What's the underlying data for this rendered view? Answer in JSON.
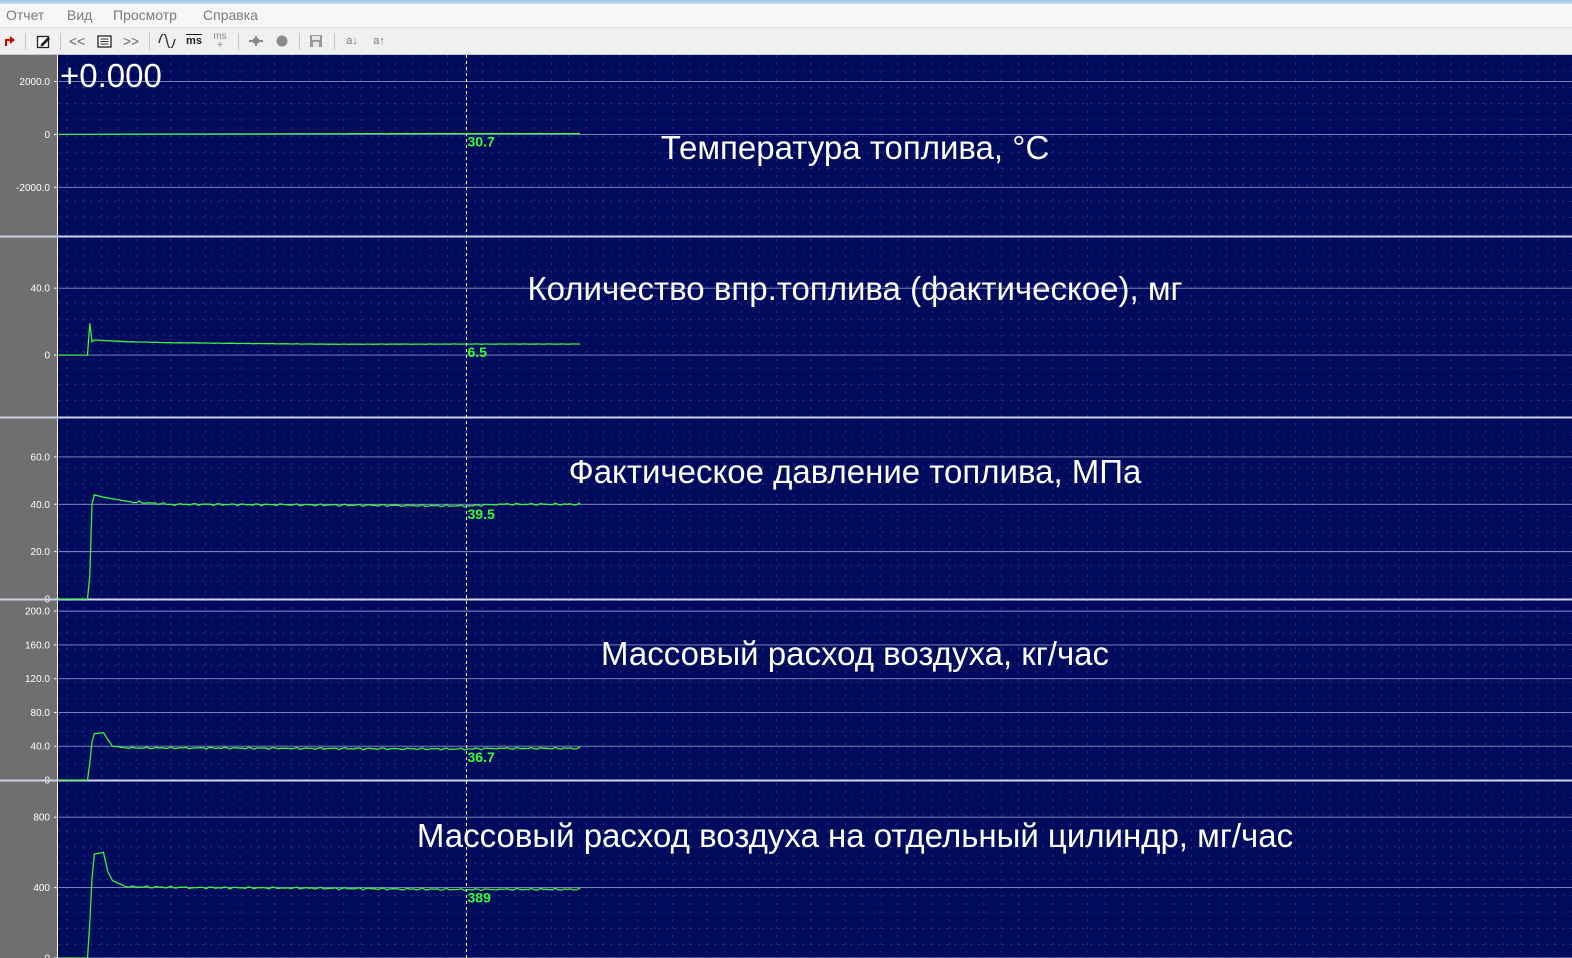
{
  "menu": [
    "Отчет",
    "Вид",
    "Просмотр",
    "Справка"
  ],
  "toolbar": {
    "ms_label": "ms",
    "ms_plus_label": "ms",
    "a_down_label": "a↓",
    "a_up_label": "a↑",
    "prev_label": "<<",
    "next_label": ">>"
  },
  "cursor_time": "+0.000",
  "colors": {
    "plot_bg": "#000b5e",
    "trace": "#3df03d",
    "axis_panel": "#6f6f6f",
    "grid": "#7d86b6"
  },
  "chart_data": [
    {
      "type": "line",
      "title": "Температура топлива, °C",
      "yticks": [
        "2000.0",
        "0",
        "-2000.0"
      ],
      "ytick_values": [
        2000,
        0,
        -2000
      ],
      "ylim": [
        -3800,
        3000
      ],
      "cursor_value": "30.7",
      "points": [
        [
          0,
          0
        ],
        [
          0.64,
          30.7
        ],
        [
          1.15,
          30.7
        ]
      ]
    },
    {
      "type": "line",
      "title": "Количество впр.топлива (фактическое), мг",
      "yticks": [
        "40.0",
        "0"
      ],
      "ytick_values": [
        40,
        0
      ],
      "ylim": [
        -37,
        70
      ],
      "cursor_value": "6.5",
      "points": [
        [
          0,
          0
        ],
        [
          0.065,
          0
        ],
        [
          0.07,
          19
        ],
        [
          0.075,
          8
        ],
        [
          0.08,
          9
        ],
        [
          0.15,
          8
        ],
        [
          0.25,
          7.4
        ],
        [
          0.4,
          7
        ],
        [
          0.6,
          6.5
        ],
        [
          0.9,
          6.6
        ],
        [
          1.15,
          6.6
        ]
      ]
    },
    {
      "type": "line",
      "title": "Фактическое давление топлива, МПа",
      "yticks": [
        "60.0",
        "40.0",
        "20.0",
        "0"
      ],
      "ytick_values": [
        60,
        40,
        20,
        0
      ],
      "ylim": [
        0,
        76
      ],
      "cursor_value": "39.5",
      "points": [
        [
          0,
          0
        ],
        [
          0.065,
          0
        ],
        [
          0.07,
          10
        ],
        [
          0.075,
          40
        ],
        [
          0.08,
          44
        ],
        [
          0.09,
          43.5
        ],
        [
          0.1,
          43
        ],
        [
          0.13,
          42
        ],
        [
          0.16,
          41
        ],
        [
          0.25,
          40
        ],
        [
          0.5,
          39.8
        ],
        [
          0.75,
          39.5
        ],
        [
          0.9,
          39.3
        ],
        [
          0.97,
          40
        ],
        [
          1.15,
          40
        ]
      ]
    },
    {
      "type": "line",
      "title": "Массовый расход воздуха, кг/час",
      "yticks": [
        "200.0",
        "160.0",
        "120.0",
        "80.0",
        "40.0",
        "0"
      ],
      "ytick_values": [
        200,
        160,
        120,
        80,
        40,
        0
      ],
      "ylim": [
        0,
        212
      ],
      "cursor_value": "36.7",
      "points": [
        [
          0,
          0
        ],
        [
          0.065,
          0
        ],
        [
          0.07,
          20
        ],
        [
          0.075,
          45
        ],
        [
          0.08,
          55
        ],
        [
          0.1,
          56
        ],
        [
          0.11,
          48
        ],
        [
          0.12,
          40
        ],
        [
          0.15,
          38
        ],
        [
          0.3,
          38
        ],
        [
          0.5,
          37.5
        ],
        [
          0.75,
          37
        ],
        [
          0.9,
          36.7
        ],
        [
          0.97,
          37.5
        ],
        [
          1.15,
          37.5
        ]
      ]
    },
    {
      "type": "line",
      "title": "Массовый расход воздуха на отдельный цилиндр, мг/час",
      "yticks": [
        "800",
        "400",
        "0"
      ],
      "ytick_values": [
        800,
        400,
        0
      ],
      "ylim": [
        0,
        1000
      ],
      "cursor_value": "389",
      "points": [
        [
          0,
          0
        ],
        [
          0.065,
          0
        ],
        [
          0.07,
          200
        ],
        [
          0.075,
          450
        ],
        [
          0.08,
          590
        ],
        [
          0.1,
          600
        ],
        [
          0.11,
          490
        ],
        [
          0.12,
          440
        ],
        [
          0.15,
          405
        ],
        [
          0.3,
          400
        ],
        [
          0.5,
          398
        ],
        [
          0.75,
          392
        ],
        [
          0.9,
          389
        ],
        [
          0.97,
          390
        ],
        [
          1.15,
          390
        ]
      ]
    }
  ]
}
